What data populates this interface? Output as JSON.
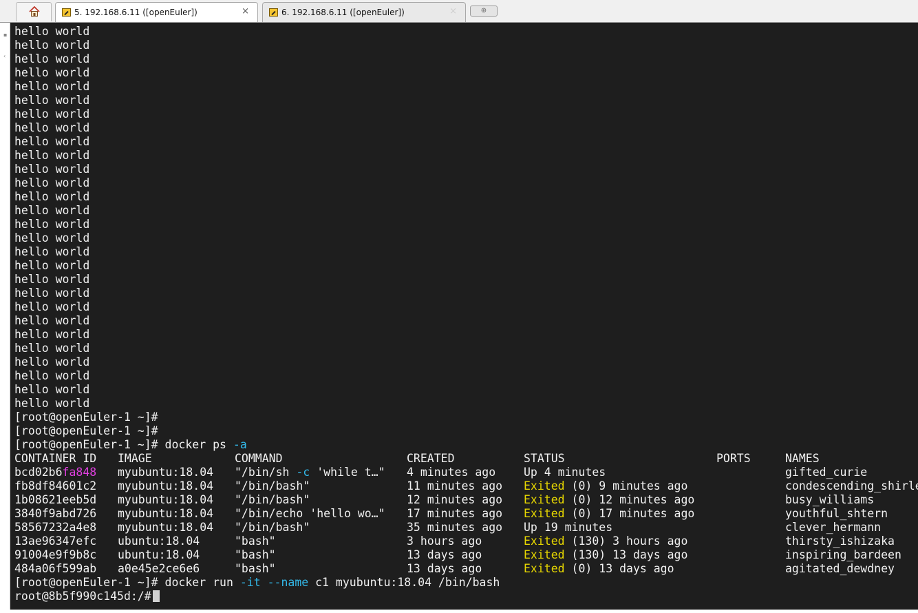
{
  "tabs": [
    {
      "label": "5. 192.168.6.11 ([openEuler])",
      "active": true
    },
    {
      "label": "6. 192.168.6.11 ([openEuler])",
      "active": false
    }
  ],
  "tab_close_glyph": "×",
  "new_tab_glyph": "⊕",
  "hello_lines": [
    "hello world",
    "hello world",
    "hello world",
    "hello world",
    "hello world",
    "hello world",
    "hello world",
    "hello world",
    "hello world",
    "hello world",
    "hello world",
    "hello world",
    "hello world",
    "hello world",
    "hello world",
    "hello world",
    "hello world",
    "hello world",
    "hello world",
    "hello world",
    "hello world",
    "hello world",
    "hello world",
    "hello world",
    "hello world",
    "hello world",
    "hello world",
    "hello world"
  ],
  "prompts": {
    "p1": "[root@openEuler-1 ~]#",
    "p2": "[root@openEuler-1 ~]#",
    "p3_prefix": "[root@openEuler-1 ~]# docker ps ",
    "p3_flag": "-a",
    "run_prefix": "[root@openEuler-1 ~]# docker run ",
    "run_flag1": "-it",
    "run_flag2": "--name",
    "run_suffix": " c1 myubuntu:18.04 /bin/bash",
    "container_prompt": "root@8b5f990c145d:/#"
  },
  "table": {
    "headers": [
      "CONTAINER ID",
      "IMAGE",
      "COMMAND",
      "CREATED",
      "STATUS",
      "PORTS",
      "NAMES"
    ],
    "rows": [
      {
        "id_a": "bcd02b6",
        "id_b": "fa848",
        "image": "myubuntu:18.04",
        "cmd_a": "\"/bin/sh ",
        "cmd_flag": "-c",
        "cmd_b": " 'while t…\"",
        "created": "4 minutes ago",
        "status_word": "",
        "status_rest": "Up 4 minutes",
        "ports": "",
        "name": "gifted_curie"
      },
      {
        "id_a": "fb8df84601c2",
        "id_b": "",
        "image": "myubuntu:18.04",
        "cmd_a": "\"/bin/bash\"",
        "cmd_flag": "",
        "cmd_b": "",
        "created": "11 minutes ago",
        "status_word": "Exited",
        "status_rest": " (0) 9 minutes ago",
        "ports": "",
        "name": "condescending_shirle"
      },
      {
        "id_a": "1b08621eeb5d",
        "id_b": "",
        "image": "myubuntu:18.04",
        "cmd_a": "\"/bin/bash\"",
        "cmd_flag": "",
        "cmd_b": "",
        "created": "12 minutes ago",
        "status_word": "Exited",
        "status_rest": " (0) 12 minutes ago",
        "ports": "",
        "name": "busy_williams"
      },
      {
        "id_a": "3840f9abd726",
        "id_b": "",
        "image": "myubuntu:18.04",
        "cmd_a": "\"/bin/echo 'hello wo…\"",
        "cmd_flag": "",
        "cmd_b": "",
        "created": "17 minutes ago",
        "status_word": "Exited",
        "status_rest": " (0) 17 minutes ago",
        "ports": "",
        "name": "youthful_shtern"
      },
      {
        "id_a": "58567232a4e8",
        "id_b": "",
        "image": "myubuntu:18.04",
        "cmd_a": "\"/bin/bash\"",
        "cmd_flag": "",
        "cmd_b": "",
        "created": "35 minutes ago",
        "status_word": "",
        "status_rest": "Up 19 minutes",
        "ports": "",
        "name": "clever_hermann"
      },
      {
        "id_a": "13ae96347efc",
        "id_b": "",
        "image": "ubuntu:18.04",
        "cmd_a": "\"bash\"",
        "cmd_flag": "",
        "cmd_b": "",
        "created": "3 hours ago",
        "status_word": "Exited",
        "status_rest": " (130) 3 hours ago",
        "ports": "",
        "name": "thirsty_ishizaka"
      },
      {
        "id_a": "91004e9f9b8c",
        "id_b": "",
        "image": "ubuntu:18.04",
        "cmd_a": "\"bash\"",
        "cmd_flag": "",
        "cmd_b": "",
        "created": "13 days ago",
        "status_word": "Exited",
        "status_rest": " (130) 13 days ago",
        "ports": "",
        "name": "inspiring_bardeen"
      },
      {
        "id_a": "484a06f599ab",
        "id_b": "",
        "image": "a0e45e2ce6e6",
        "cmd_a": "\"bash\"",
        "cmd_flag": "",
        "cmd_b": "",
        "created": "13 days ago",
        "status_word": "Exited",
        "status_rest": " (0) 13 days ago",
        "ports": "",
        "name": "agitated_dewdney"
      }
    ]
  },
  "colors": {
    "terminal_bg": "#1e1e1e",
    "terminal_fg": "#f0f0f0",
    "flag": "#33b8e8",
    "exited": "#e8d800",
    "magenta": "#e040e0"
  },
  "icons": [
    "home-icon",
    "terminal-icon",
    "close-icon",
    "new-tab-icon"
  ]
}
